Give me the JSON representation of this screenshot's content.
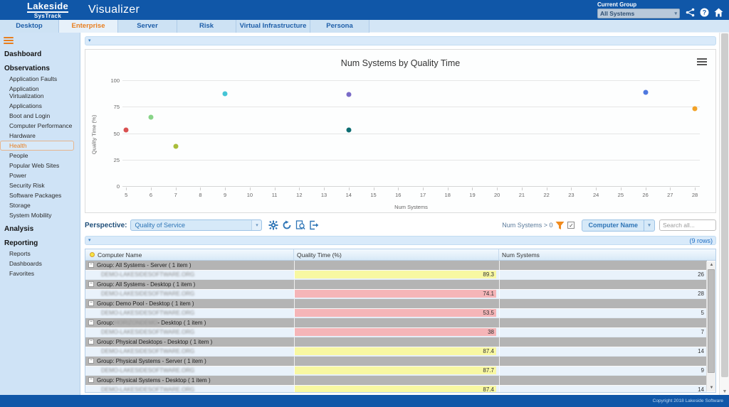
{
  "header": {
    "logo_line1": "Lakeside",
    "logo_line2": "SysTrack",
    "app_title": "Visualizer",
    "current_group_label": "Current Group",
    "current_group_value": "All Systems"
  },
  "tabs": [
    {
      "label": "Desktop",
      "active": false
    },
    {
      "label": "Enterprise",
      "active": true
    },
    {
      "label": "Server",
      "active": false
    },
    {
      "label": "Risk",
      "active": false
    },
    {
      "label": "Virtual Infrastructure",
      "active": false
    },
    {
      "label": "Persona",
      "active": false
    }
  ],
  "sidebar": {
    "selected_item": "Health",
    "sections": [
      {
        "header": "Dashboard",
        "items": []
      },
      {
        "header": "Observations",
        "items": [
          "Application Faults",
          "Application Virtualization",
          "Applications",
          "Boot and Login",
          "Computer Performance",
          "Hardware",
          "Health",
          "People",
          "Popular Web Sites",
          "Power",
          "Security Risk",
          "Software Packages",
          "Storage",
          "System Mobility"
        ]
      },
      {
        "header": "Analysis",
        "items": []
      },
      {
        "header": "Reporting",
        "items": [
          "Reports",
          "Dashboards",
          "Favorites"
        ]
      }
    ]
  },
  "chart_panel": {
    "chart_data": {
      "type": "scatter",
      "title": "Num Systems by Quality Time",
      "xlabel": "Num Systems",
      "ylabel": "Quality Time (%)",
      "xlim": [
        4.85,
        28.2
      ],
      "ylim": [
        0,
        100
      ],
      "x_ticks": [
        5,
        6,
        7,
        8,
        9,
        10,
        11,
        12,
        13,
        14,
        15,
        16,
        17,
        18,
        19,
        20,
        21,
        22,
        23,
        24,
        25,
        26,
        27,
        28
      ],
      "y_ticks": [
        0,
        25,
        50,
        75,
        100
      ],
      "grid": true,
      "legend": "none",
      "points": [
        {
          "x": 5,
          "y": 53.5,
          "color": "#d95151"
        },
        {
          "x": 6,
          "y": 66,
          "color": "#88d488"
        },
        {
          "x": 7,
          "y": 38,
          "color": "#a9bd3b"
        },
        {
          "x": 9,
          "y": 87.7,
          "color": "#45c5d6"
        },
        {
          "x": 14,
          "y": 87.4,
          "color": "#7a6bc7"
        },
        {
          "x": 14,
          "y": 54,
          "color": "#0d6d72"
        },
        {
          "x": 26,
          "y": 89.3,
          "color": "#4f79df"
        },
        {
          "x": 28,
          "y": 74.1,
          "color": "#f2a227"
        }
      ]
    }
  },
  "perspective_bar": {
    "label": "Perspective:",
    "value": "Quality of Service",
    "filter_text": "Num Systems > 0",
    "filter_checked": true,
    "group_by_value": "Computer Name",
    "search_placeholder": "Search all..."
  },
  "table_panel": {
    "rows_badge": "(9 rows)",
    "columns": [
      "Computer Name",
      "Quality Time (%)",
      "Num Systems"
    ],
    "redacted_name": "DEMO-LAKESIDESOFTWARE.ORG",
    "rows": [
      {
        "type": "group",
        "label": "Group: All Systems - Server ( 1 item )"
      },
      {
        "type": "data",
        "quality": "89.3",
        "highlight": "yellow",
        "num": "26"
      },
      {
        "type": "group",
        "label": "Group: All Systems - Desktop ( 1 item )"
      },
      {
        "type": "data",
        "quality": "74.1",
        "highlight": "red",
        "num": "28"
      },
      {
        "type": "group",
        "label": "Group: Demo Pool - Desktop ( 1 item )"
      },
      {
        "type": "data",
        "quality": "53.5",
        "highlight": "red",
        "num": "5"
      },
      {
        "type": "group",
        "prefix": "Group: ",
        "blurred": "HORIZONDEMO",
        "suffix": " - Desktop ( 1 item )"
      },
      {
        "type": "data",
        "quality": "38",
        "highlight": "red",
        "num": "7"
      },
      {
        "type": "group",
        "label": "Group: Physical Desktops - Desktop ( 1 item )"
      },
      {
        "type": "data",
        "quality": "87.4",
        "highlight": "yellow",
        "num": "14"
      },
      {
        "type": "group",
        "label": "Group: Physical Systems - Server ( 1 item )"
      },
      {
        "type": "data",
        "quality": "87.7",
        "highlight": "yellow",
        "num": "9"
      },
      {
        "type": "group",
        "label": "Group: Physical Systems - Desktop ( 1 item )"
      },
      {
        "type": "data",
        "quality": "87.4",
        "highlight": "yellow",
        "num": "14"
      }
    ]
  },
  "footer": {
    "copyright": "Copyright 2018 Lakeside Software"
  },
  "colors": {
    "header_blue": "#1057a8",
    "accent_orange": "#e87e1e",
    "highlight_yellow": "#f8f8a2",
    "highlight_red": "#f5b5b8",
    "sidebar_blue": "#cfe3f6"
  }
}
